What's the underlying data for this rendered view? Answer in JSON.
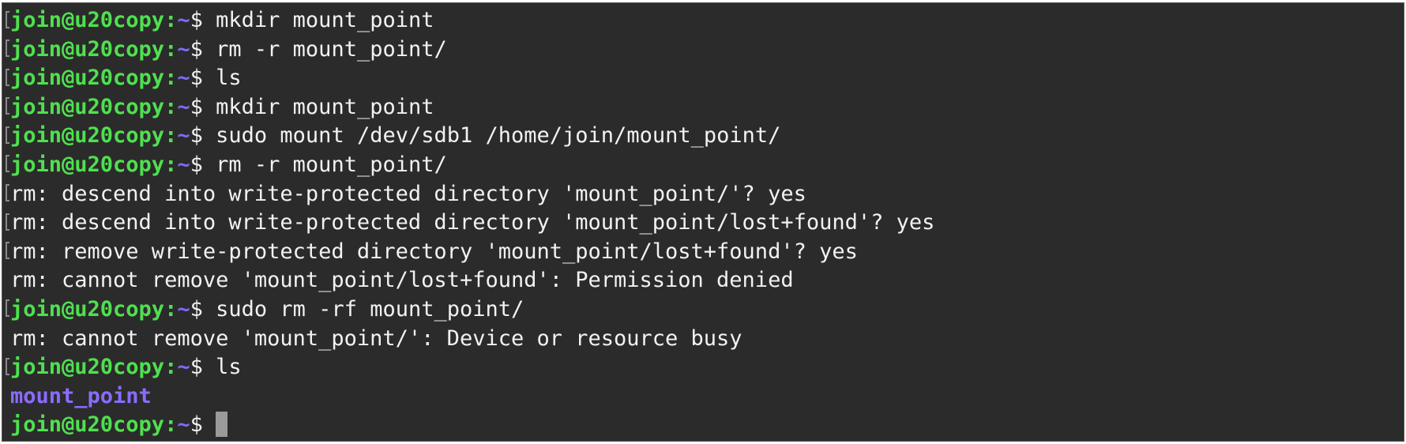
{
  "prompt": {
    "user_host": "join@u20copy",
    "separator": ":",
    "path": "~",
    "dollar": "$"
  },
  "lines": [
    {
      "type": "cmd",
      "text": "mkdir mount_point"
    },
    {
      "type": "cmd",
      "text": "rm -r mount_point/"
    },
    {
      "type": "cmd",
      "text": "ls"
    },
    {
      "type": "cmd",
      "text": "mkdir mount_point"
    },
    {
      "type": "cmd",
      "text": "sudo mount /dev/sdb1 /home/join/mount_point/"
    },
    {
      "type": "cmd",
      "text": "rm -r mount_point/"
    },
    {
      "type": "out",
      "text": "rm: descend into write-protected directory 'mount_point/'? yes"
    },
    {
      "type": "out",
      "text": "rm: descend into write-protected directory 'mount_point/lost+found'? yes"
    },
    {
      "type": "out",
      "text": "rm: remove write-protected directory 'mount_point/lost+found'? yes"
    },
    {
      "type": "out",
      "text": "rm: cannot remove 'mount_point/lost+found': Permission denied"
    },
    {
      "type": "cmd",
      "text": "sudo rm -rf mount_point/"
    },
    {
      "type": "out",
      "text": "rm: cannot remove 'mount_point/': Device or resource busy"
    },
    {
      "type": "cmd",
      "text": "ls"
    },
    {
      "type": "dir",
      "text": "mount_point"
    },
    {
      "type": "active",
      "text": ""
    }
  ]
}
